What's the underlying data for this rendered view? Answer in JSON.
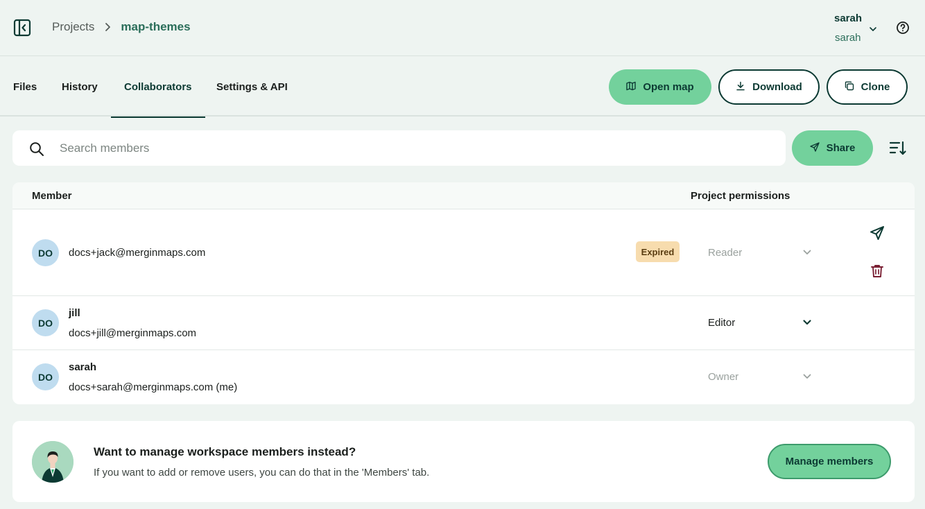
{
  "header": {
    "breadcrumb": {
      "projects": "Projects",
      "current": "map-themes"
    },
    "user": {
      "name": "sarah",
      "workspace": "sarah"
    }
  },
  "tabs": [
    {
      "label": "Files"
    },
    {
      "label": "History"
    },
    {
      "label": "Collaborators",
      "active": true
    },
    {
      "label": "Settings & API"
    }
  ],
  "actions": {
    "open_map": "Open map",
    "download": "Download",
    "clone": "Clone"
  },
  "search": {
    "placeholder": "Search members",
    "value": ""
  },
  "share_label": "Share",
  "table": {
    "columns": {
      "member": "Member",
      "permissions": "Project permissions"
    },
    "rows": [
      {
        "initials": "DO",
        "name": "",
        "email": "docs+jack@merginmaps.com",
        "badge": "Expired",
        "permission": "Reader",
        "editable": false
      },
      {
        "initials": "DO",
        "name": "jill",
        "email": "docs+jill@merginmaps.com",
        "badge": "",
        "permission": "Editor",
        "editable": true
      },
      {
        "initials": "DO",
        "name": "sarah",
        "email": "docs+sarah@merginmaps.com (me)",
        "badge": "",
        "permission": "Owner",
        "editable": false
      }
    ]
  },
  "manage": {
    "title": "Want to manage workspace members instead?",
    "description": "If you want to add or remove users, you can do that in the 'Members' tab.",
    "button": "Manage members"
  },
  "colors": {
    "primary_dark": "#0c3a33",
    "accent_green": "#73d19c",
    "badge_bg": "#f7dcae",
    "danger": "#7a1f33"
  }
}
